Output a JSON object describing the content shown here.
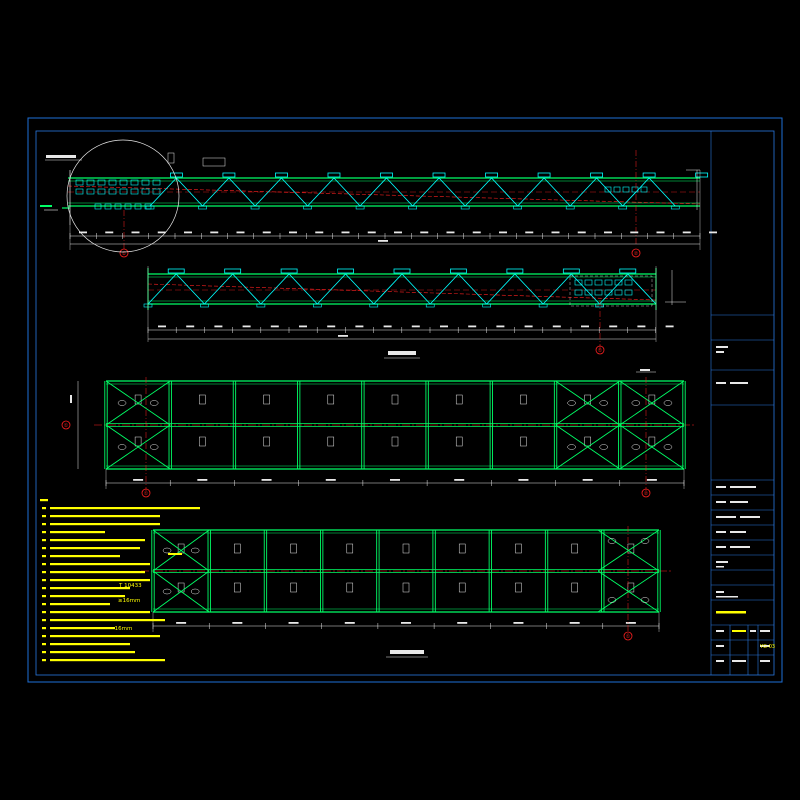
{
  "colors": {
    "background": "#000000",
    "frame": "#1e6fd8",
    "steel": "#00ff66",
    "cyan": "#00ffff",
    "red": "#ff2020",
    "yellow": "#ffff00",
    "white": "#e8e8e8"
  },
  "notes": {
    "n10_code": "T 10433",
    "n10_size": "≥16mm",
    "n12_size": "=16mm"
  },
  "elevation_upper": {
    "grid_bubbles": [
      "①",
      "②"
    ],
    "panel_count": 10,
    "detail_circle": "detail-circle"
  },
  "elevation_lower": {
    "grid_bubbles": [
      "①"
    ],
    "panel_count": 9
  },
  "plan_upper": {
    "axis_labels": [
      "①",
      "②"
    ],
    "bay_count": 9,
    "left_dim": "500"
  },
  "plan_lower": {
    "axis_labels": [
      "①"
    ],
    "bay_count": 9
  },
  "title_block": {
    "drawing_no_label": "YG-03"
  }
}
